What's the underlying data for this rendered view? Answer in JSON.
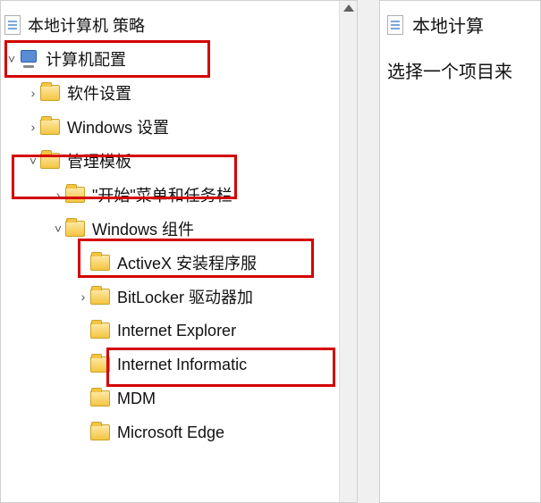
{
  "tree": {
    "root_label": "本地计算机 策略",
    "computer_config": "计算机配置",
    "software_settings": "软件设置",
    "windows_settings": "Windows 设置",
    "admin_templates": "管理模板",
    "start_menu": "\"开始\"菜单和任务栏",
    "windows_components": "Windows 组件",
    "activex": "ActiveX 安装程序服",
    "bitlocker": "BitLocker 驱动器加",
    "ie": "Internet Explorer",
    "iis": "Internet Informatic",
    "mdm": "MDM",
    "edge": "Microsoft Edge"
  },
  "right": {
    "title": "本地计算",
    "text": "选择一个项目来"
  }
}
